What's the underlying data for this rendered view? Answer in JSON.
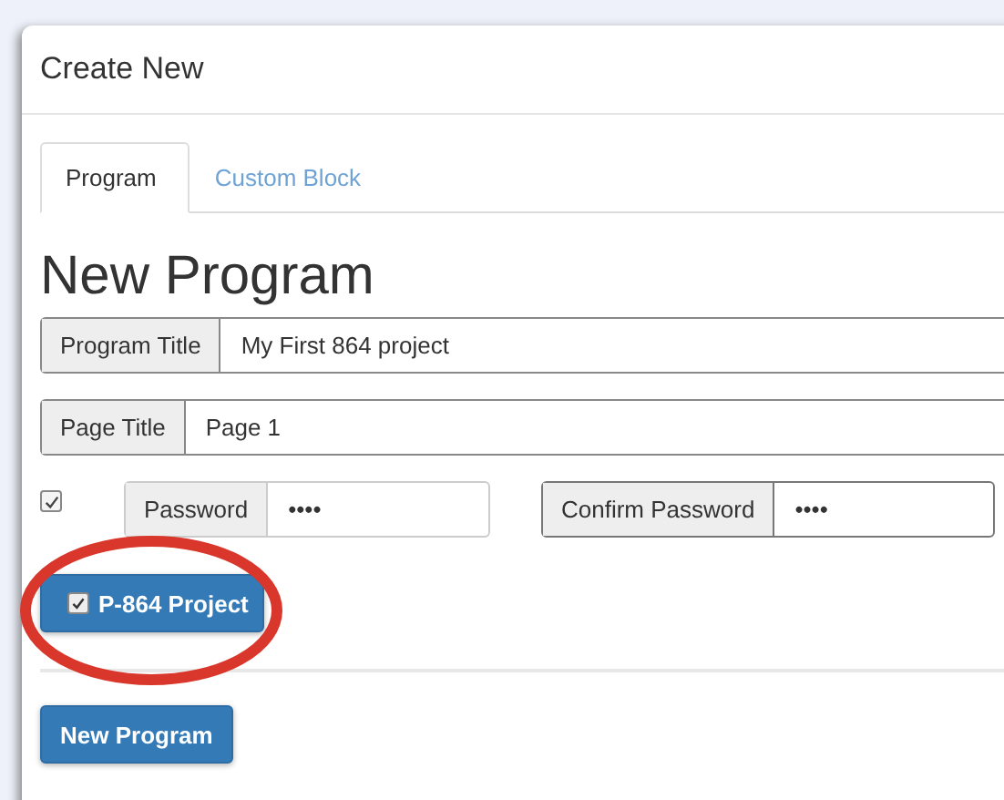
{
  "dialog": {
    "title": "Create New"
  },
  "tabs": [
    {
      "label": "Program",
      "selected": true
    },
    {
      "label": "Custom Block",
      "selected": false
    }
  ],
  "heading": "New Program",
  "fields": [
    {
      "label": "Program Title",
      "value": "My First 864 project"
    },
    {
      "label": "Page Title",
      "value": "Page 1"
    }
  ],
  "password": {
    "checked": true,
    "fields": [
      {
        "label": "Password",
        "value": "••••"
      },
      {
        "label": "Confirm Password",
        "value": "••••"
      }
    ]
  },
  "project_toggle": {
    "label": "P-864 Project",
    "checked": true,
    "highlighted": true
  },
  "submit_button": "New Program"
}
